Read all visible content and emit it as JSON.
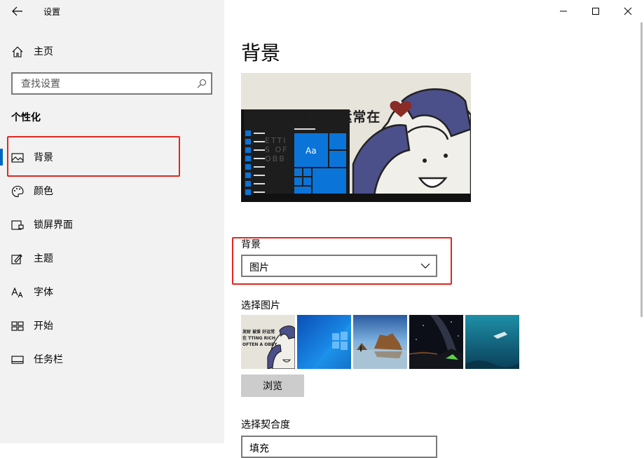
{
  "window": {
    "title": "设置",
    "minimize_icon": "minimize-icon",
    "maximize_icon": "maximize-icon",
    "close_icon": "close-icon"
  },
  "sidebar": {
    "home_label": "主页",
    "search_placeholder": "查找设置",
    "section_title": "个性化",
    "items": [
      {
        "label": "背景",
        "icon": "picture-icon",
        "selected": true
      },
      {
        "label": "颜色",
        "icon": "palette-icon"
      },
      {
        "label": "锁屏界面",
        "icon": "lockscreen-icon"
      },
      {
        "label": "主题",
        "icon": "brush-icon"
      },
      {
        "label": "字体",
        "icon": "font-icon"
      },
      {
        "label": "开始",
        "icon": "start-icon"
      },
      {
        "label": "任务栏",
        "icon": "taskbar-icon"
      }
    ]
  },
  "main": {
    "title": "背景",
    "preview": {
      "banner_text": "发财 被爱 好运常在",
      "tile_text": "Aa",
      "side_text": "ETTI S OF OBB"
    },
    "background_label": "背景",
    "background_value": "图片",
    "choose_picture_label": "选择图片",
    "thumbnails": [
      {
        "name": "thumb-cartoon",
        "text": "发财 被爱 好运常在 TTING RICH OFTEN A OBBY"
      },
      {
        "name": "thumb-windows-blue"
      },
      {
        "name": "thumb-beach-rocks"
      },
      {
        "name": "thumb-night-sky"
      },
      {
        "name": "thumb-underwater"
      }
    ],
    "browse_label": "浏览",
    "fit_label": "选择契合度",
    "fit_value": "填充"
  },
  "colors": {
    "accent": "#0067c0",
    "highlight": "#e0271f",
    "sidebar_bg": "#f2f2f2"
  }
}
